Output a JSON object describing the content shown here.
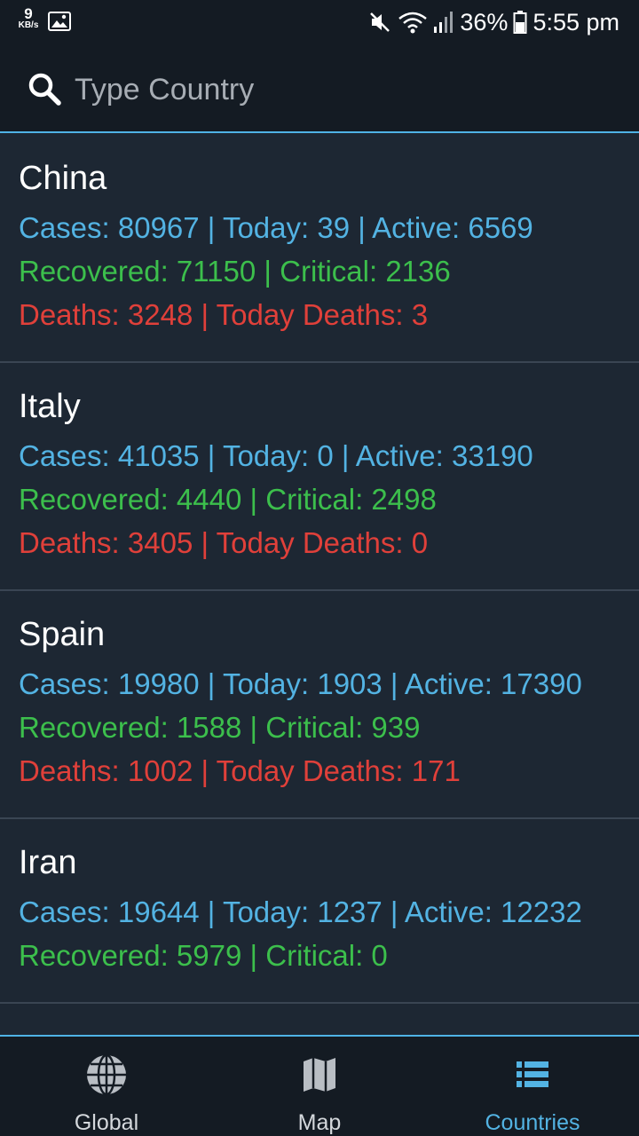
{
  "status_bar": {
    "net_speed": "9",
    "net_unit": "KB/s",
    "battery": "36%",
    "time": "5:55 pm",
    "icons": [
      "image-icon",
      "mute-icon",
      "wifi-icon",
      "signal-icon",
      "battery-icon"
    ]
  },
  "search": {
    "placeholder": "Type Country",
    "value": "",
    "icon": "search-icon"
  },
  "countries": [
    {
      "name": "China",
      "cases_line": "Cases: 80967 | Today: 39 | Active: 6569",
      "recovered_line": "Recovered: 71150 | Critical: 2136",
      "deaths_line": "Deaths: 3248 | Today Deaths: 3"
    },
    {
      "name": "Italy",
      "cases_line": "Cases: 41035 | Today: 0 | Active: 33190",
      "recovered_line": "Recovered: 4440 | Critical: 2498",
      "deaths_line": "Deaths: 3405 | Today Deaths: 0"
    },
    {
      "name": "Spain",
      "cases_line": "Cases: 19980 | Today: 1903 | Active: 17390",
      "recovered_line": "Recovered: 1588 | Critical: 939",
      "deaths_line": "Deaths: 1002 | Today Deaths: 171"
    },
    {
      "name": "Iran",
      "cases_line": "Cases: 19644 | Today: 1237 | Active: 12232",
      "recovered_line": "Recovered: 5979 | Critical: 0",
      "deaths_line": ""
    }
  ],
  "bottom_nav": {
    "items": [
      {
        "label": "Global",
        "icon": "globe-icon",
        "active": false
      },
      {
        "label": "Map",
        "icon": "map-icon",
        "active": false
      },
      {
        "label": "Countries",
        "icon": "list-icon",
        "active": true
      }
    ]
  },
  "colors": {
    "background": "#1d2733",
    "bar": "#141b23",
    "accent": "#4fb3e6",
    "cases": "#53b3e3",
    "recovered": "#3cbf4c",
    "deaths": "#e0403a"
  }
}
